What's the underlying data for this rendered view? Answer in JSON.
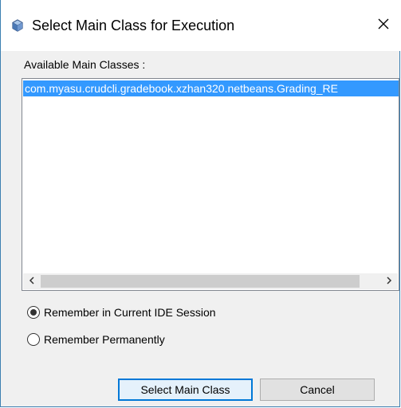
{
  "dialog": {
    "title": "Select Main Class for Execution",
    "close_glyph": "✕"
  },
  "main_classes": {
    "label": "Available Main Classes :",
    "items": [
      "com.myasu.crudcli.gradebook.xzhan320.netbeans.Grading_RE"
    ],
    "selected_index": 0
  },
  "options": {
    "remember_session": "Remember in Current IDE Session",
    "remember_permanently": "Remember Permanently",
    "selected": "remember_session"
  },
  "buttons": {
    "select_label": "Select Main Class",
    "cancel_label": "Cancel"
  },
  "colors": {
    "selection": "#3399ff",
    "accent": "#0078d7"
  }
}
